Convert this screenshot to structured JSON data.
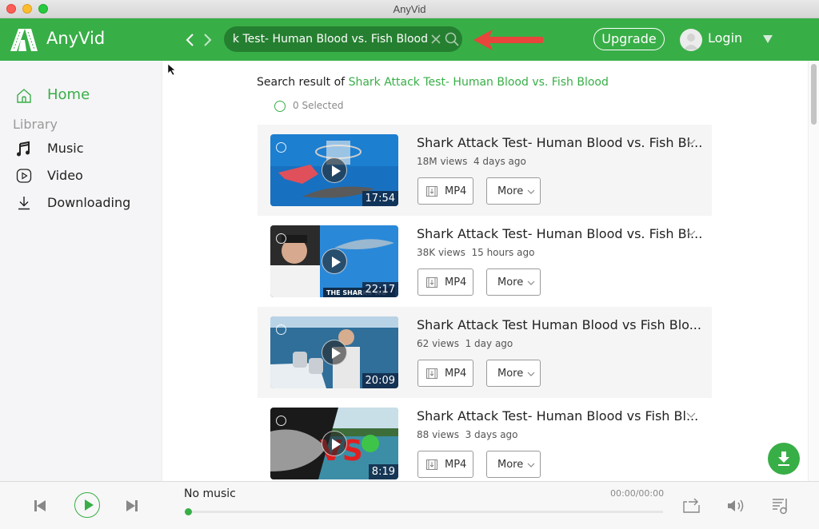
{
  "window": {
    "title": "AnyVid"
  },
  "header": {
    "app_name": "AnyVid",
    "search_value": "Shark Attack Test- Human Blood vs. Fish Blood",
    "upgrade_label": "Upgrade",
    "login_label": "Login"
  },
  "sidebar": {
    "home_label": "Home",
    "library_label": "Library",
    "items": [
      {
        "label": "Music",
        "icon": "music-note-icon"
      },
      {
        "label": "Video",
        "icon": "video-play-icon"
      },
      {
        "label": "Downloading",
        "icon": "download-icon"
      }
    ]
  },
  "main": {
    "result_prefix": "Search result of",
    "query": "Shark Attack Test- Human Blood vs. Fish Blood",
    "selected_text": "0 Selected",
    "mp4_label": "MP4",
    "more_label": "More",
    "videos": [
      {
        "title": "Shark Attack Test- Human Blood vs. Fish Bl...",
        "views": "18M views",
        "age": "4 days ago",
        "duration": "17:54",
        "expandable": true
      },
      {
        "title": "Shark Attack Test- Human Blood vs. Fish Bl...",
        "views": "38K views",
        "age": "15 hours ago",
        "duration": "22:17",
        "expandable": true
      },
      {
        "title": "Shark Attack Test Human Blood vs Fish Blo...",
        "views": "62 views",
        "age": "1 day ago",
        "duration": "20:09",
        "expandable": false
      },
      {
        "title": "Shark Attack Test- Human Blood vs Fish Bl...",
        "views": "88 views",
        "age": "3 days ago",
        "duration": "8:19",
        "expandable": true
      }
    ]
  },
  "player": {
    "track": "No music",
    "time": "00:00/00:00",
    "progress": 0
  },
  "colors": {
    "accent": "#38ae47",
    "search_bg": "#257f30",
    "arrow": "#e8453c"
  }
}
